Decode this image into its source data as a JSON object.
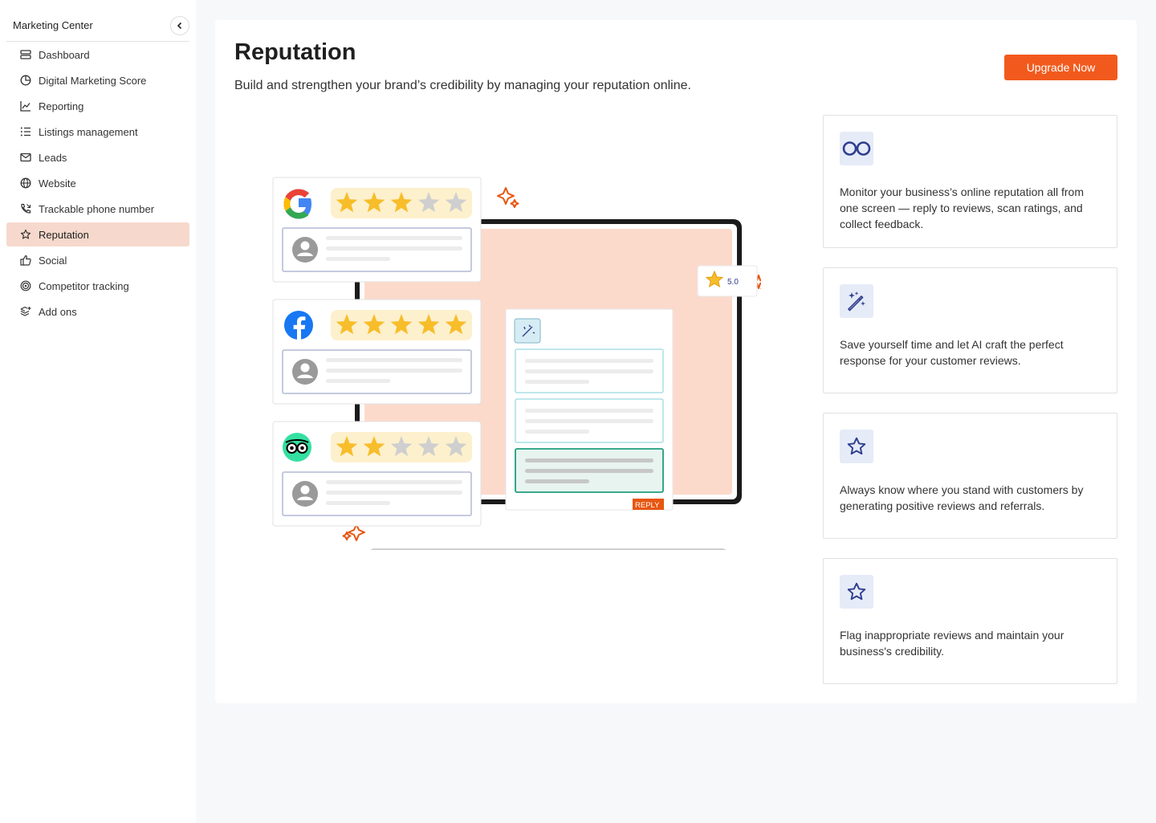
{
  "sidebar": {
    "title": "Marketing Center",
    "items": [
      {
        "label": "Dashboard",
        "icon": "dashboard-icon"
      },
      {
        "label": "Digital Marketing Score",
        "icon": "pie-chart-icon"
      },
      {
        "label": "Reporting",
        "icon": "line-chart-icon"
      },
      {
        "label": "Listings management",
        "icon": "list-icon"
      },
      {
        "label": "Leads",
        "icon": "mail-icon"
      },
      {
        "label": "Website",
        "icon": "globe-icon"
      },
      {
        "label": "Trackable phone number",
        "icon": "phone-icon"
      },
      {
        "label": "Reputation",
        "icon": "star-icon",
        "active": true
      },
      {
        "label": "Social",
        "icon": "thumbs-up-icon"
      },
      {
        "label": "Competitor tracking",
        "icon": "target-icon"
      },
      {
        "label": "Add ons",
        "icon": "layers-plus-icon"
      }
    ]
  },
  "main": {
    "title": "Reputation",
    "subtitle": "Build and strengthen your brand’s credibility by managing your reputation online.",
    "upgrade_label": "Upgrade Now"
  },
  "features": [
    {
      "icon": "infinity-icon",
      "text": "Monitor your business’s online reputation all from one screen — reply to reviews, scan ratings, and collect feedback."
    },
    {
      "icon": "magic-wand-icon",
      "text": "Save yourself time and let AI craft the perfect response for your customer reviews."
    },
    {
      "icon": "star-icon",
      "text": "Always know where you stand with customers by generating positive reviews and referrals."
    },
    {
      "icon": "star-icon",
      "text": "Flag inappropriate reviews and maintain your business's credibility."
    }
  ],
  "illustration": {
    "rating_badge": "5.0",
    "reply_tag": "REPLY",
    "reviews": [
      {
        "source": "google-logo-icon",
        "stars": 3
      },
      {
        "source": "facebook-logo-icon",
        "stars": 5
      },
      {
        "source": "tripadvisor-logo-icon",
        "stars": 2
      }
    ]
  },
  "colors": {
    "accent": "#f25a1d",
    "active_nav": "#f6d9cc",
    "icon_bg": "#e6ebf8",
    "icon_fg": "#2f3f8f",
    "star": "#f7bd2a",
    "screen": "#fcdacb"
  }
}
